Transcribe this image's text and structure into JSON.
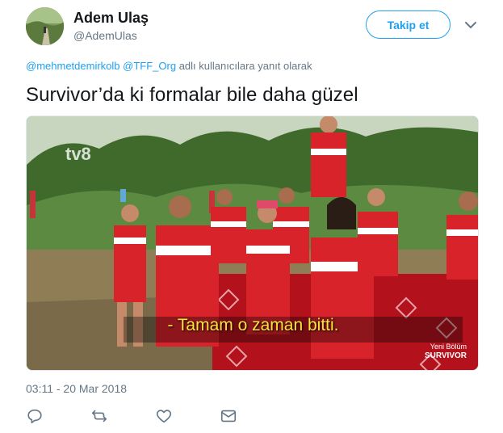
{
  "author": {
    "name": "Adem Ulaş",
    "handle": "@AdemUlas"
  },
  "follow_button": {
    "label": "Takip et"
  },
  "reply_to": {
    "mentions": [
      "@mehmetdemirkolb",
      "@TFF_Org"
    ],
    "suffix": "adlı kullanıcılara yanıt olarak"
  },
  "tweet": {
    "text": "Survivor’da ki formalar bile daha güzel",
    "timestamp": "03:11 - 20 Mar 2018"
  },
  "media": {
    "channel_logo": "tv8",
    "subtitle": "- Tamam o zaman bitti.",
    "corner_label_top": "Yeni Bölüm",
    "corner_label_bottom": "SURVIVOR"
  },
  "actions": [
    {
      "icon": "reply-icon"
    },
    {
      "icon": "retweet-icon"
    },
    {
      "icon": "like-icon"
    },
    {
      "icon": "direct-message-icon"
    }
  ],
  "colors": {
    "accent": "#1da1f2",
    "muted": "#657786",
    "text": "#14171a",
    "jersey_red": "#d8232a"
  }
}
